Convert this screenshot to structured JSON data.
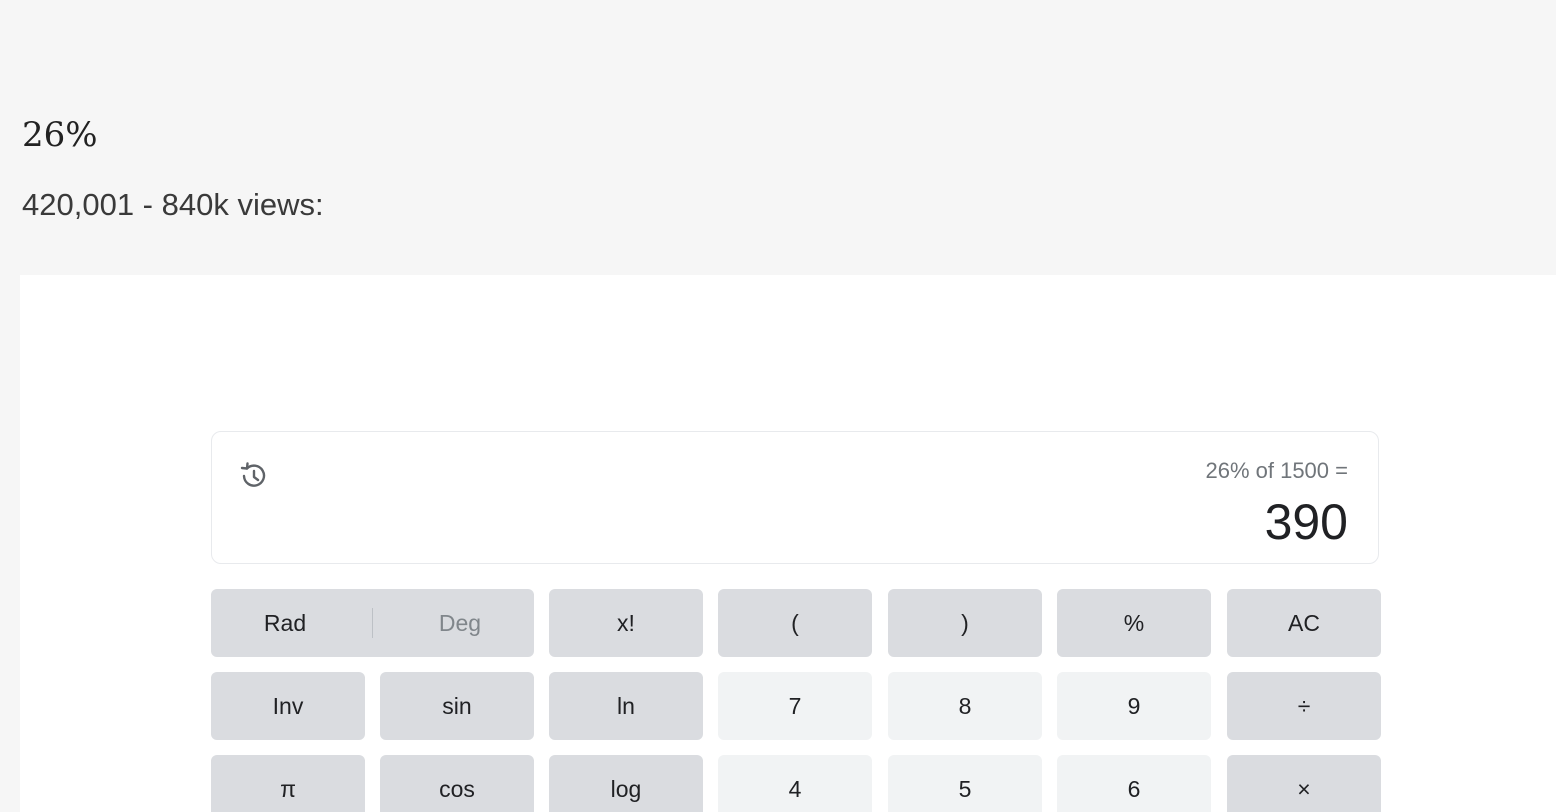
{
  "header": {
    "title": "26%",
    "subtitle": "420,001 - 840k views:"
  },
  "calculator": {
    "expression": "26% of 1500 =",
    "result": "390",
    "angle_mode": {
      "rad": "Rad",
      "deg": "Deg",
      "selected": "Rad"
    },
    "rows": [
      [
        "x!",
        "(",
        ")",
        "%",
        "AC"
      ],
      [
        "Inv",
        "sin",
        "ln",
        "7",
        "8",
        "9",
        "÷"
      ],
      [
        "π",
        "cos",
        "log",
        "4",
        "5",
        "6",
        "×"
      ]
    ]
  },
  "colors": {
    "page_background": "#f6f6f6",
    "card_background": "#ffffff",
    "function_button": "#dadce0",
    "digit_button": "#f1f3f4",
    "text": "#202124",
    "muted_text": "#70757a"
  },
  "icons": {
    "history": "history-icon"
  }
}
